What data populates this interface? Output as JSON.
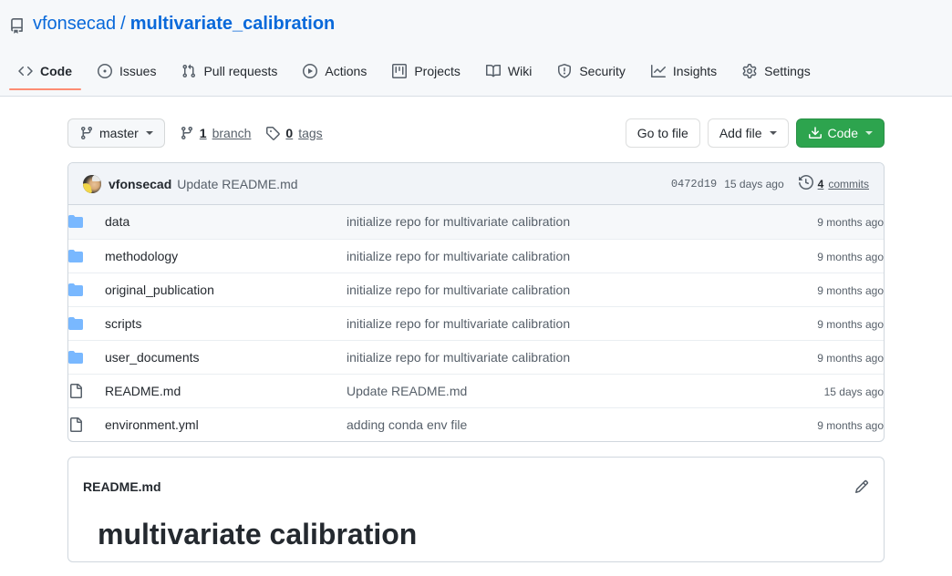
{
  "repo": {
    "icon": "repo-icon",
    "owner": "vfonsecad",
    "separator": "/",
    "name": "multivariate_calibration"
  },
  "nav": {
    "items": [
      {
        "label": "Code",
        "icon": "code-icon",
        "selected": true
      },
      {
        "label": "Issues",
        "icon": "issue-opened-icon",
        "selected": false
      },
      {
        "label": "Pull requests",
        "icon": "git-pull-request-icon",
        "selected": false
      },
      {
        "label": "Actions",
        "icon": "play-icon",
        "selected": false
      },
      {
        "label": "Projects",
        "icon": "project-icon",
        "selected": false
      },
      {
        "label": "Wiki",
        "icon": "book-icon",
        "selected": false
      },
      {
        "label": "Security",
        "icon": "shield-icon",
        "selected": false
      },
      {
        "label": "Insights",
        "icon": "graph-icon",
        "selected": false
      },
      {
        "label": "Settings",
        "icon": "gear-icon",
        "selected": false
      }
    ],
    "active_underline_color": "#fd8c73"
  },
  "filenav": {
    "branch_button": "master",
    "branch_count_value": "1",
    "branch_count_label": "branch",
    "tag_count_value": "0",
    "tag_count_label": "tags",
    "go_to_file": "Go to file",
    "add_file": "Add file",
    "code_button": "Code",
    "code_button_color": "#2da44e"
  },
  "latest_commit": {
    "author": "vfonsecad",
    "message": "Update README.md",
    "sha": "0472d19",
    "date": "15 days ago",
    "commits_value": "4",
    "commits_label": "commits"
  },
  "files": {
    "rows": [
      {
        "type": "folder",
        "name": "data",
        "message": "initialize repo for multivariate calibration",
        "age": "9 months ago"
      },
      {
        "type": "folder",
        "name": "methodology",
        "message": "initialize repo for multivariate calibration",
        "age": "9 months ago"
      },
      {
        "type": "folder",
        "name": "original_publication",
        "message": "initialize repo for multivariate calibration",
        "age": "9 months ago"
      },
      {
        "type": "folder",
        "name": "scripts",
        "message": "initialize repo for multivariate calibration",
        "age": "9 months ago"
      },
      {
        "type": "folder",
        "name": "user_documents",
        "message": "initialize repo for multivariate calibration",
        "age": "9 months ago"
      },
      {
        "type": "file",
        "name": "README.md",
        "message": "Update README.md",
        "age": "15 days ago"
      },
      {
        "type": "file",
        "name": "environment.yml",
        "message": "adding conda env file",
        "age": "9 months ago"
      }
    ],
    "folder_icon_color": "#79b8ff",
    "file_icon_color": "#57606a"
  },
  "readme": {
    "title": "README.md",
    "edit_icon": "pencil-icon",
    "heading": "multivariate calibration"
  }
}
